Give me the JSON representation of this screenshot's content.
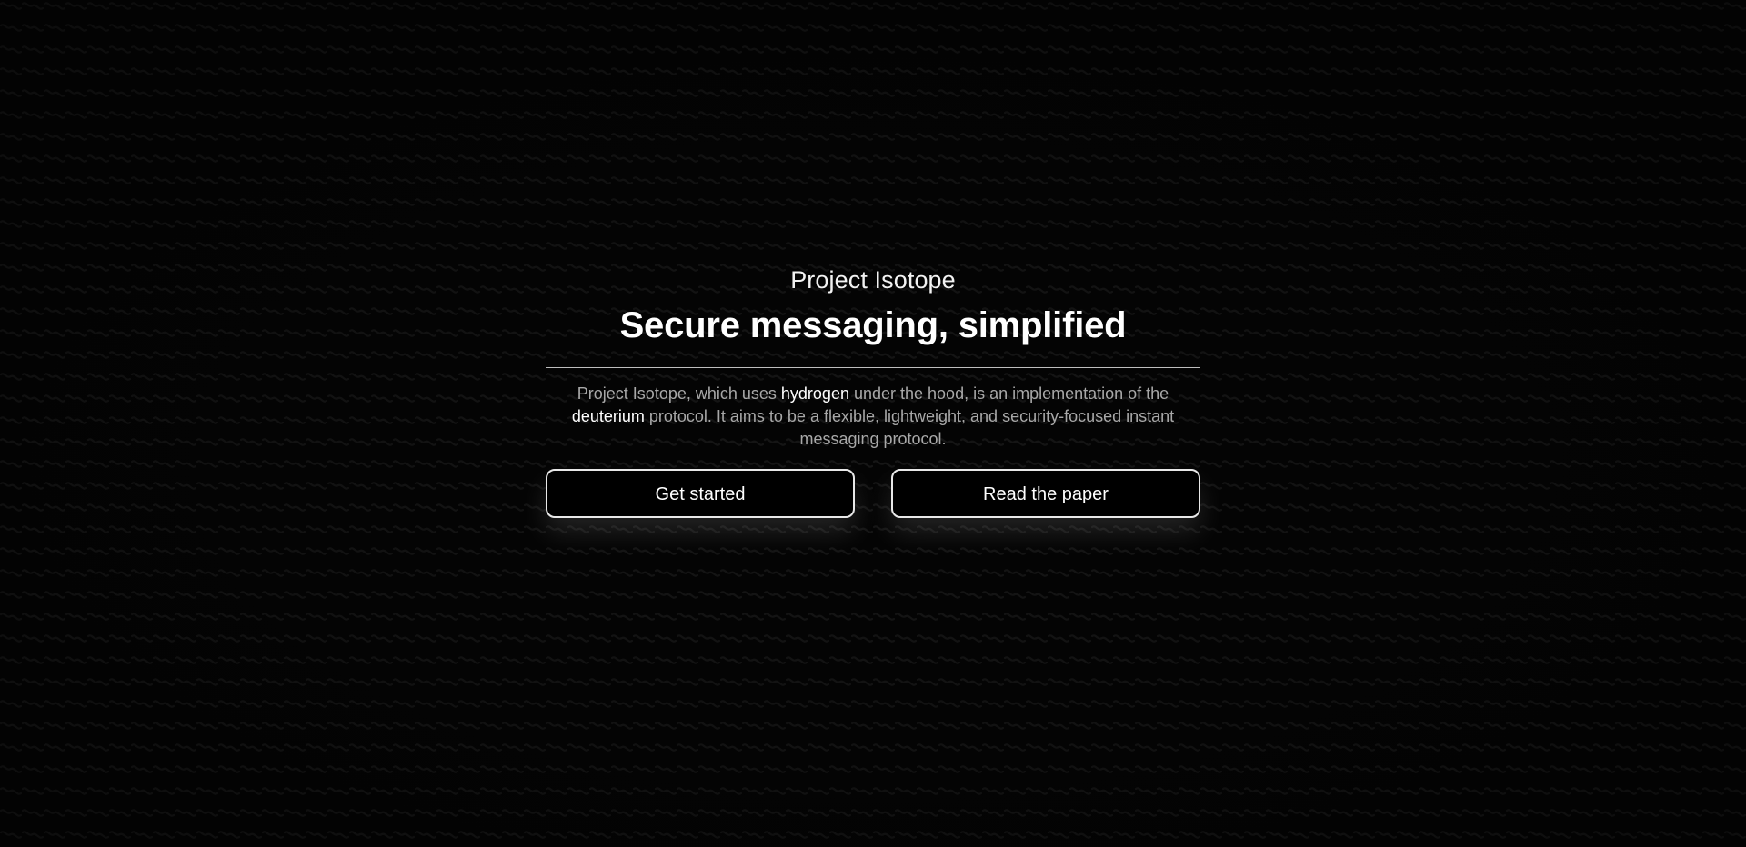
{
  "hero": {
    "eyebrow": "Project Isotope",
    "headline": "Secure messaging, simplified",
    "description": {
      "part1": "Project Isotope, which uses ",
      "highlight1": "hydrogen",
      "part2": " under the hood, is an implementation of the ",
      "highlight2": "deuterium",
      "part3": " protocol. It aims to be a flexible, lightweight, and security-focused instant messaging protocol."
    }
  },
  "actions": {
    "primary_label": "Get started",
    "secondary_label": "Read the paper"
  },
  "colors": {
    "background": "#060606",
    "pattern": "#1d1d1d",
    "text": "#ffffff",
    "muted_text": "#a8a8a8",
    "border": "#e8e8e8"
  }
}
